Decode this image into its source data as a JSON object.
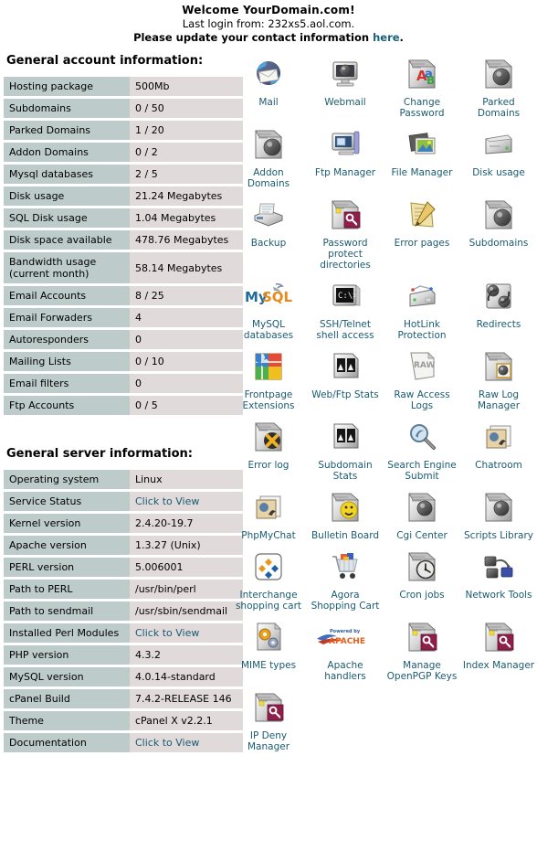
{
  "header": {
    "welcome": "Welcome YourDomain.com!",
    "last_login_prefix": "Last login from: ",
    "last_login_host": "232xs5.aol.com.",
    "update_prefix": "Please update your contact information ",
    "update_link": "here",
    "update_suffix": "."
  },
  "account": {
    "title": "General account information:",
    "rows": [
      {
        "label": "Hosting package",
        "value": "500Mb"
      },
      {
        "label": "Subdomains",
        "value": "0 / 50"
      },
      {
        "label": "Parked Domains",
        "value": "1 / 20"
      },
      {
        "label": "Addon Domains",
        "value": "0 / 2"
      },
      {
        "label": "Mysql databases",
        "value": "2 / 5"
      },
      {
        "label": "Disk usage",
        "value": "21.24 Megabytes"
      },
      {
        "label": "SQL Disk usage",
        "value": "1.04 Megabytes"
      },
      {
        "label": "Disk space available",
        "value": "478.76 Megabytes"
      },
      {
        "label": "Bandwidth usage (current month)",
        "value": "58.14 Megabytes"
      },
      {
        "label": "Email Accounts",
        "value": "8 / 25"
      },
      {
        "label": "Email Forwaders",
        "value": "4"
      },
      {
        "label": "Autoresponders",
        "value": "0"
      },
      {
        "label": "Mailing Lists",
        "value": "0 / 10"
      },
      {
        "label": "Email filters",
        "value": "0"
      },
      {
        "label": "Ftp Accounts",
        "value": "0 / 5"
      }
    ]
  },
  "server": {
    "title": "General server information:",
    "rows": [
      {
        "label": "Operating system",
        "value": "Linux",
        "is_link": false
      },
      {
        "label": "Service Status",
        "value": "Click to View",
        "is_link": true
      },
      {
        "label": "Kernel version",
        "value": "2.4.20-19.7",
        "is_link": false
      },
      {
        "label": "Apache version",
        "value": "1.3.27 (Unix)",
        "is_link": false
      },
      {
        "label": "PERL version",
        "value": "5.006001",
        "is_link": false
      },
      {
        "label": "Path to PERL",
        "value": "/usr/bin/perl",
        "is_link": false
      },
      {
        "label": "Path to sendmail",
        "value": "/usr/sbin/sendmail",
        "is_link": false
      },
      {
        "label": "Installed Perl Modules",
        "value": "Click to View",
        "is_link": true
      },
      {
        "label": "PHP version",
        "value": "4.3.2",
        "is_link": false
      },
      {
        "label": "MySQL version",
        "value": "4.0.14-standard",
        "is_link": false
      },
      {
        "label": "cPanel Build",
        "value": "7.4.2-RELEASE 146",
        "is_link": false
      },
      {
        "label": "Theme",
        "value": "cPanel X v2.2.1",
        "is_link": false
      },
      {
        "label": "Documentation",
        "value": "Click to View",
        "is_link": true
      }
    ]
  },
  "icons": [
    {
      "label": "Mail",
      "icon": "mail-icon"
    },
    {
      "label": "Webmail",
      "icon": "webmail-monitor-icon"
    },
    {
      "label": "Change Password",
      "icon": "change-password-icon"
    },
    {
      "label": "Parked Domains",
      "icon": "parked-domains-icon"
    },
    {
      "label": "Addon Domains",
      "icon": "addon-domains-icon"
    },
    {
      "label": "Ftp Manager",
      "icon": "ftp-manager-icon"
    },
    {
      "label": "File Manager",
      "icon": "file-manager-icon"
    },
    {
      "label": "Disk usage",
      "icon": "disk-usage-icon"
    },
    {
      "label": "Backup",
      "icon": "backup-icon"
    },
    {
      "label": "Password protect directories",
      "icon": "password-protect-icon"
    },
    {
      "label": "Error pages",
      "icon": "error-pages-icon"
    },
    {
      "label": "Subdomains",
      "icon": "subdomains-icon"
    },
    {
      "label": "MySQL databases",
      "icon": "mysql-logo-icon"
    },
    {
      "label": "SSH/Telnet shell access",
      "icon": "shell-access-icon"
    },
    {
      "label": "HotLink Protection",
      "icon": "hotlink-protection-icon"
    },
    {
      "label": "Redirects",
      "icon": "redirects-icon"
    },
    {
      "label": "Frontpage Extensions",
      "icon": "frontpage-puzzle-icon"
    },
    {
      "label": "Web/Ftp Stats",
      "icon": "web-stats-icon"
    },
    {
      "label": "Raw Access Logs",
      "icon": "raw-access-logs-icon"
    },
    {
      "label": "Raw Log Manager",
      "icon": "raw-log-manager-icon"
    },
    {
      "label": "Error log",
      "icon": "error-log-icon"
    },
    {
      "label": "Subdomain Stats",
      "icon": "subdomain-stats-icon"
    },
    {
      "label": "Search Engine Submit",
      "icon": "search-magnifier-icon"
    },
    {
      "label": "Chatroom",
      "icon": "chatroom-icon"
    },
    {
      "label": "PhpMyChat",
      "icon": "phpmychat-icon"
    },
    {
      "label": "Bulletin Board",
      "icon": "bulletin-board-smiley-icon"
    },
    {
      "label": "Cgi Center",
      "icon": "cgi-center-icon"
    },
    {
      "label": "Scripts Library",
      "icon": "scripts-library-icon"
    },
    {
      "label": "Interchange shopping cart",
      "icon": "interchange-diamond-icon"
    },
    {
      "label": "Agora Shopping Cart",
      "icon": "shopping-cart-icon"
    },
    {
      "label": "Cron jobs",
      "icon": "cron-clock-icon"
    },
    {
      "label": "Network Tools",
      "icon": "network-tools-icon"
    },
    {
      "label": "MIME types",
      "icon": "mime-types-gears-icon"
    },
    {
      "label": "Apache handlers",
      "icon": "apache-feather-icon"
    },
    {
      "label": "Manage OpenPGP Keys",
      "icon": "openpgp-key-icon"
    },
    {
      "label": "Index Manager",
      "icon": "index-manager-key-icon"
    },
    {
      "label": "IP Deny Manager",
      "icon": "ip-deny-key-icon"
    }
  ],
  "colors": {
    "key_cell": "#bdcccb",
    "value_cell": "#e1dada",
    "link": "#1a5b70",
    "page_background": "#ffffff"
  }
}
